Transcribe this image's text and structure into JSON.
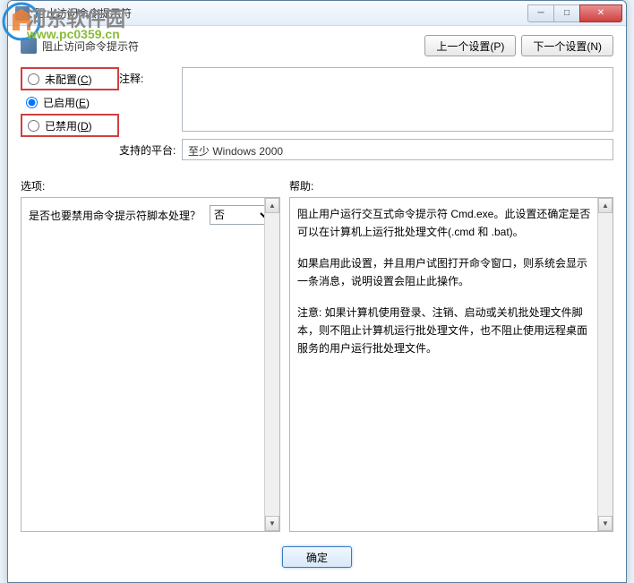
{
  "watermark": {
    "text": "河东软件园",
    "url": "www.pc0359.cn"
  },
  "titlebar": {
    "title": "阻止访问命令提示符"
  },
  "header": {
    "title": "阻止访问命令提示符",
    "prev_btn": "上一个设置(P)",
    "next_btn": "下一个设置(N)"
  },
  "radios": {
    "not_configured": "未配置(C)",
    "enabled": "已启用(E)",
    "disabled": "已禁用(D)"
  },
  "fields": {
    "comment_label": "注释:",
    "platform_label": "支持的平台:",
    "platform_value": "至少 Windows 2000"
  },
  "section_labels": {
    "options": "选项:",
    "help": "帮助:"
  },
  "options": {
    "question": "是否也要禁用命令提示符脚本处理？",
    "selected": "否"
  },
  "help": {
    "p1": "阻止用户运行交互式命令提示符 Cmd.exe。此设置还确定是否可以在计算机上运行批处理文件(.cmd 和 .bat)。",
    "p2": "如果启用此设置，并且用户试图打开命令窗口，则系统会显示一条消息，说明设置会阻止此操作。",
    "p3": "注意: 如果计算机使用登录、注销、启动或关机批处理文件脚本，则不阻止计算机运行批处理文件，也不阻止使用远程桌面服务的用户运行批处理文件。"
  },
  "footer": {
    "ok": "确定"
  }
}
